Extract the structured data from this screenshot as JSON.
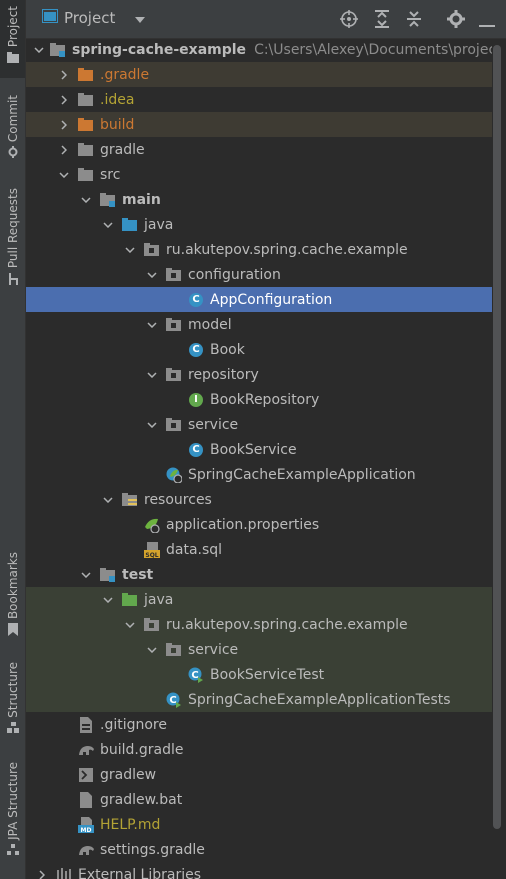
{
  "toolstripe": {
    "project": "Project",
    "commit": "Commit",
    "pull_requests": "Pull Requests",
    "bookmarks": "Bookmarks",
    "structure": "Structure",
    "jpa_structure": "JPA Structure"
  },
  "header": {
    "title": "Project"
  },
  "tree": {
    "root_name": "spring-cache-example",
    "root_path": "C:\\Users\\Alexey\\Documents\\projects\\sp",
    "items": [
      "spring-cache-example",
      ".gradle",
      ".idea",
      "build",
      "gradle",
      "src",
      "main",
      "java",
      "ru.akutepov.spring.cache.example",
      "configuration",
      "AppConfiguration",
      "model",
      "Book",
      "repository",
      "BookRepository",
      "service",
      "BookService",
      "SpringCacheExampleApplication",
      "resources",
      "application.properties",
      "data.sql",
      "test",
      "java",
      "ru.akutepov.spring.cache.example",
      "service",
      "BookServiceTest",
      "SpringCacheExampleApplicationTests",
      ".gitignore",
      "build.gradle",
      "gradlew",
      "gradlew.bat",
      "HELP.md",
      "settings.gradle",
      "External Libraries"
    ]
  },
  "colors": {
    "selection": "#4b6eaf",
    "excluded_bg": "#3e3b33",
    "test_bg": "#3a4035",
    "excluded_text": "#cc7832",
    "ignored_text": "#b3a335"
  }
}
